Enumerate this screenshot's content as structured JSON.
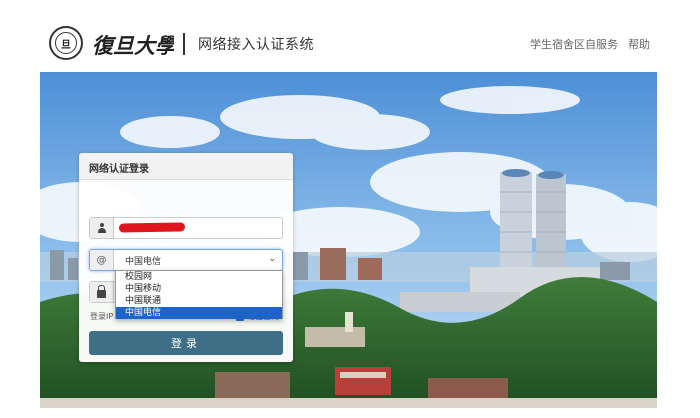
{
  "header": {
    "emblem_text": "旦",
    "calligraphy": "復旦大學",
    "system_title": "网络接入认证系统",
    "nav": {
      "dorm_self_service": "学生宿舍区自服务",
      "help": "帮助"
    }
  },
  "login": {
    "title": "网络认证登录",
    "carrier_selected": "中国电信",
    "carrier_options": [
      "校园网",
      "中国移动",
      "中国联通",
      "中国电信"
    ],
    "at_symbol": "@",
    "remember_label": "登录IP",
    "remember_right": "记住密码",
    "submit_label": "登录"
  },
  "colors": {
    "accent": "#3f6e87",
    "select_highlight": "#1e63c8",
    "redaction": "#e0161d"
  },
  "icons": {
    "username": "user-icon",
    "password": "lock-icon",
    "dropdown": "chevron-down-icon",
    "emblem": "university-emblem-icon"
  }
}
